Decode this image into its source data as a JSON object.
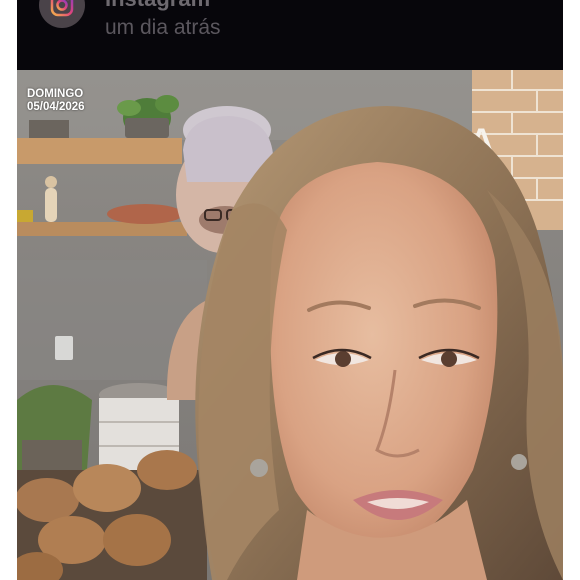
{
  "post_header": {
    "app_name": "Instagram",
    "post_time": "um dia atrás"
  },
  "video": {
    "date_stamp": {
      "weekday": "DOMINGO",
      "date": "05/04/2026"
    },
    "wall_letter": "A"
  },
  "colors": {
    "header_background": "#07060b",
    "page_background": "#ffffff"
  }
}
